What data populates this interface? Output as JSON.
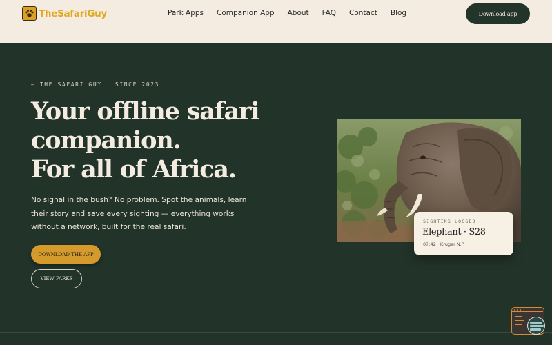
{
  "header": {
    "logo_text": "TheSafariGuy",
    "nav": [
      "Park Apps",
      "Companion App",
      "About",
      "FAQ",
      "Contact",
      "Blog"
    ],
    "download_label": "Download app"
  },
  "hero": {
    "eyebrow": "— THE SAFARI GUY · SINCE 2023",
    "headline_lines": [
      "Your offline safari",
      "companion.",
      "For all of Africa."
    ],
    "description": "No signal in the bush? No problem. Spot the animals, learn their story and save every sighting — everything works without a network, built for the real safari.",
    "primary_button": "DOWNLOAD THE APP",
    "secondary_button": "VIEW PARKS"
  },
  "sighting_card": {
    "label": "SIGHTING LOGGED",
    "title": "Elephant · S28",
    "subtitle": "07:42 · Kruger N.P."
  },
  "colors": {
    "background": "#22332a",
    "header_bg": "#f4ece0",
    "accent": "#d49a2b",
    "cream": "#f4ece0"
  },
  "icons": {
    "logo": "paw-icon",
    "widget": "app-window-icon"
  }
}
